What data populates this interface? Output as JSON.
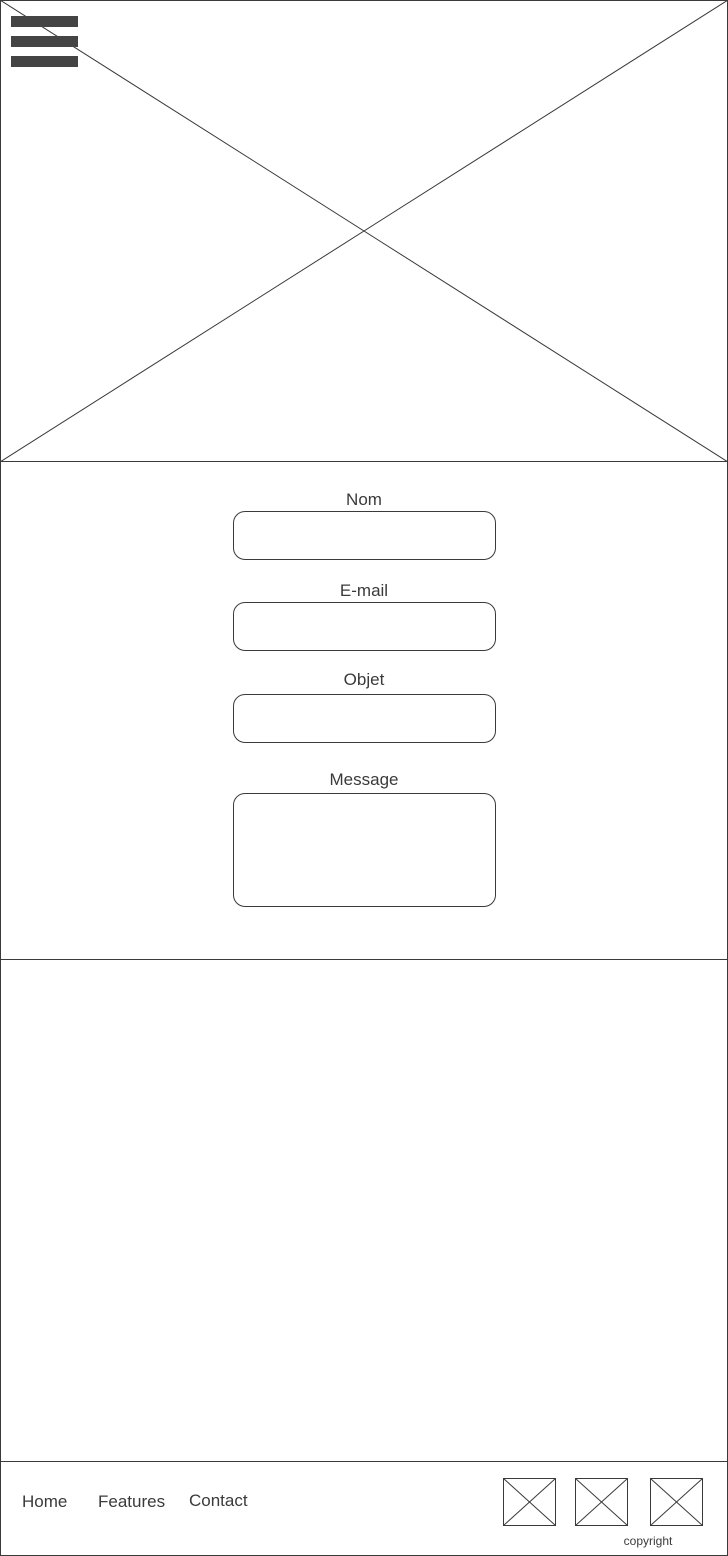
{
  "hero": {
    "image_icon": "image-placeholder-icon",
    "menu_icon": "hamburger-menu-icon"
  },
  "form": {
    "fields": [
      {
        "label": "Nom",
        "value": "",
        "placeholder": ""
      },
      {
        "label": "E-mail",
        "value": "",
        "placeholder": ""
      },
      {
        "label": "Objet",
        "value": "",
        "placeholder": ""
      },
      {
        "label": "Message",
        "value": "",
        "placeholder": ""
      }
    ]
  },
  "footer": {
    "nav": [
      {
        "label": "Home"
      },
      {
        "label": "Features"
      },
      {
        "label": "Contact"
      }
    ],
    "social_icons": [
      "social-image-placeholder-icon",
      "social-image-placeholder-icon",
      "social-image-placeholder-icon"
    ],
    "copyright": "copyright"
  },
  "colors": {
    "stroke": "#3a3a3a",
    "menu_bar": "#444444",
    "background": "#ffffff"
  }
}
